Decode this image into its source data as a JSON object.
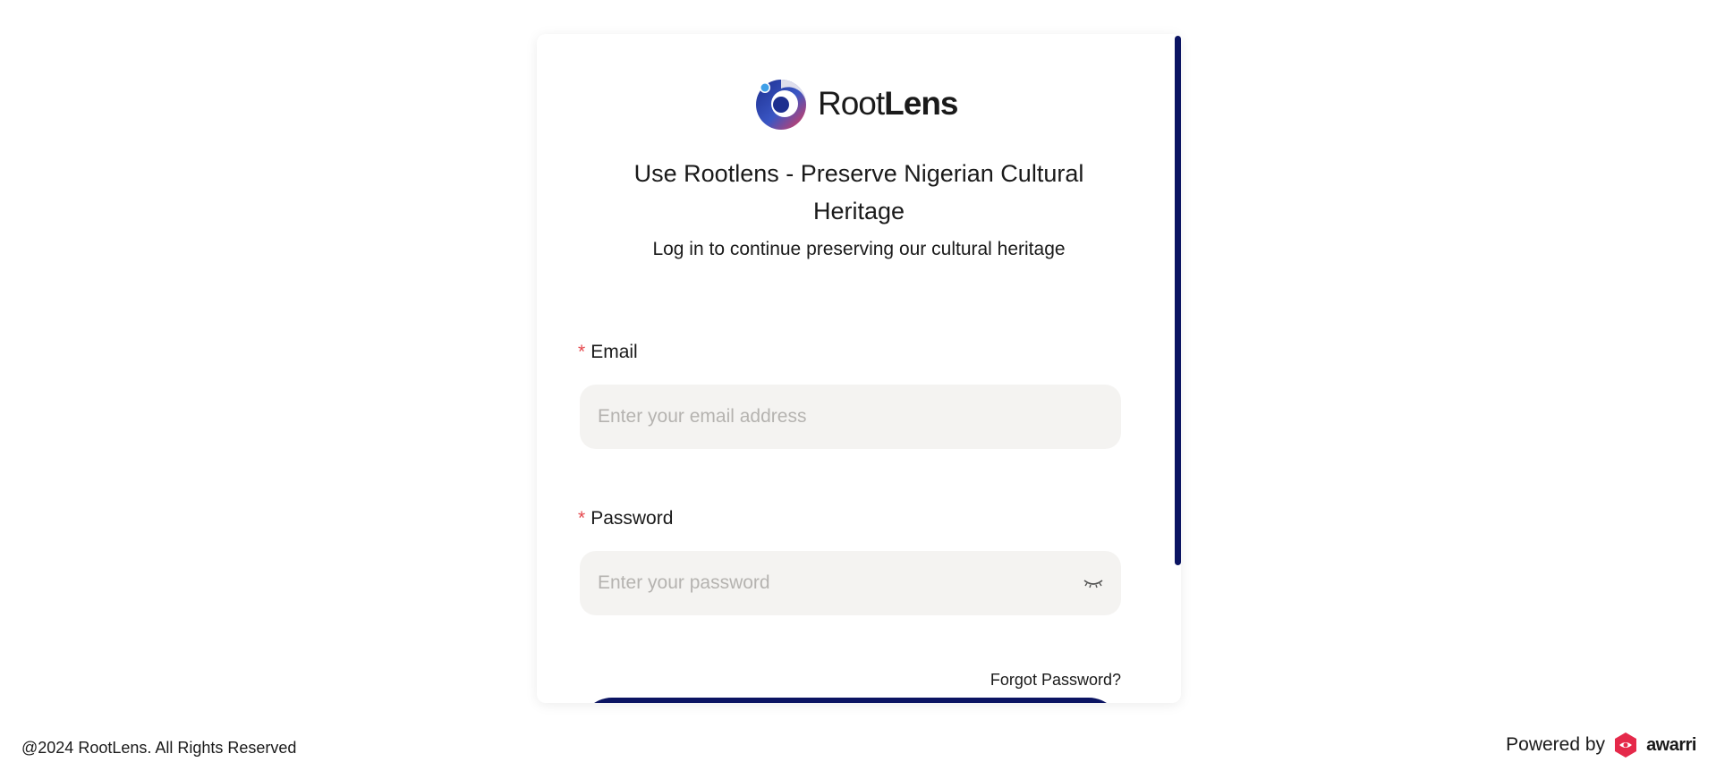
{
  "brand": {
    "name_part1": "Root",
    "name_part2": "Lens",
    "accent_color": "#0b1462",
    "logo_icon": "rootlens-logo-icon"
  },
  "header": {
    "title": "Use Rootlens - Preserve Nigerian Cultural Heritage",
    "subtitle": "Log in to continue preserving our cultural heritage"
  },
  "form": {
    "email": {
      "required_marker": "*",
      "label": "Email",
      "placeholder": "Enter your email address",
      "value": ""
    },
    "password": {
      "required_marker": "*",
      "label": "Password",
      "placeholder": "Enter your password",
      "value": "",
      "toggle_icon": "eye-closed-icon"
    },
    "forgot_password": "Forgot Password?"
  },
  "footer": {
    "copyright": "@2024 RootLens. All Rights Reserved",
    "powered_by": "Powered by",
    "powered_brand": "awarri",
    "powered_icon": "awarri-logo-icon"
  }
}
